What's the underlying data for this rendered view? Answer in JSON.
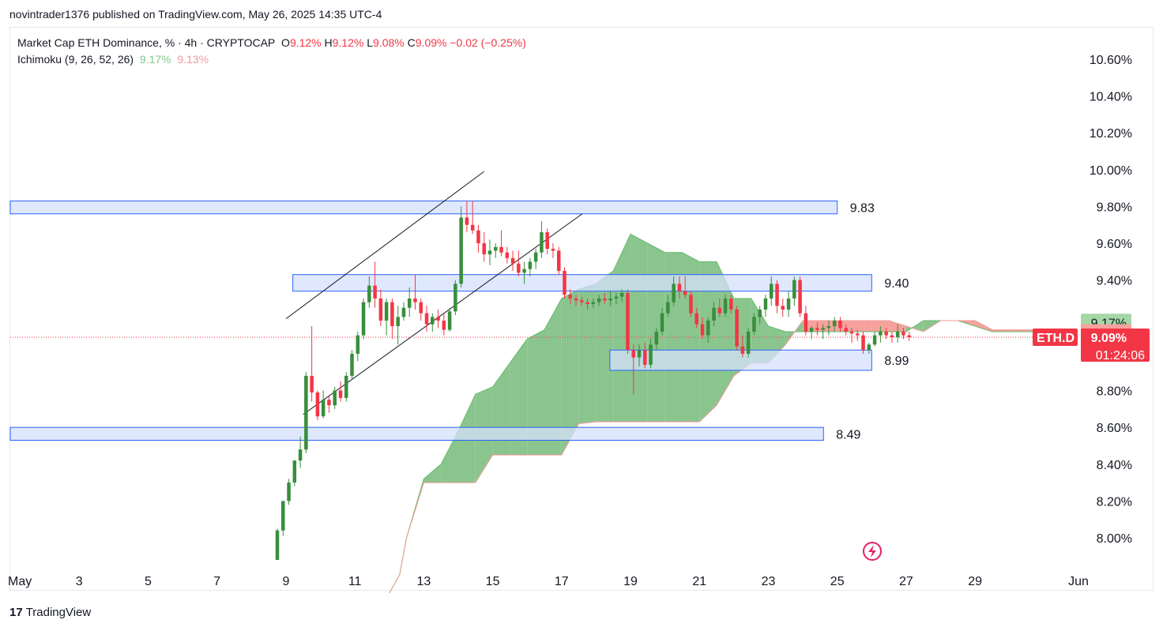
{
  "header": {
    "publish_line": "novintrader1376 published on TradingView.com, May 26, 2025 14:35 UTC-4"
  },
  "legend": {
    "symbol_line": "Market Cap ETH Dominance, % · 4h · CRYPTOCAP",
    "o_label": "O",
    "o_value": "9.12%",
    "h_label": "H",
    "h_value": "9.12%",
    "l_label": "L",
    "l_value": "9.08%",
    "c_label": "C",
    "c_value": "9.09%",
    "change": "−0.02 (−0.25%)",
    "indicator": "Ichimoku (9, 26, 52, 26)",
    "ind_val1": "9.17%",
    "ind_val2": "9.13%"
  },
  "brand": {
    "logo_text": "17",
    "name": "TradingView"
  },
  "colors": {
    "up": "#388e3c",
    "down": "#f23645",
    "cloud_bull": "#8bc58e",
    "cloud_bear": "#f6a19d",
    "zone_fill": "#d4e0fb",
    "zone_stroke": "#2962ff",
    "price_label": "#f23645"
  },
  "chart_data": {
    "type": "candlestick",
    "symbol": "ETH.D",
    "timeframe": "4h",
    "ylim": [
      7.85,
      10.75
    ],
    "y_ticks": [
      "8.00%",
      "8.20%",
      "8.40%",
      "8.60%",
      "8.80%",
      "9.40%",
      "9.60%",
      "9.80%",
      "10.00%",
      "10.20%",
      "10.40%",
      "10.60%"
    ],
    "y_tick_values": [
      8.0,
      8.2,
      8.4,
      8.6,
      8.8,
      9.4,
      9.6,
      9.8,
      10.0,
      10.2,
      10.4,
      10.6
    ],
    "x_ticks": [
      "May",
      "3",
      "5",
      "7",
      "9",
      "11",
      "13",
      "15",
      "17",
      "19",
      "21",
      "23",
      "25",
      "27",
      "29",
      "Jun"
    ],
    "x_tick_days": [
      1,
      3,
      5,
      7,
      9,
      11,
      13,
      15,
      17,
      19,
      21,
      23,
      25,
      27,
      29,
      32
    ],
    "xlim_days": [
      1.0,
      32.0
    ],
    "zones": [
      {
        "low": 9.76,
        "high": 9.83,
        "label": "9.83",
        "start_day": 1.0,
        "end_day": 25.0
      },
      {
        "low": 9.34,
        "high": 9.43,
        "label": "9.40",
        "start_day": 9.2,
        "end_day": 26.0
      },
      {
        "low": 8.91,
        "high": 9.02,
        "label": "8.99",
        "start_day": 18.4,
        "end_day": 26.0
      },
      {
        "low": 8.53,
        "high": 8.6,
        "label": "8.49",
        "start_day": 1.0,
        "end_day": 24.6
      }
    ],
    "channel_lines": [
      {
        "from": [
          9.0,
          9.19
        ],
        "to": [
          14.75,
          9.99
        ]
      },
      {
        "from": [
          9.5,
          8.67
        ],
        "to": [
          17.6,
          9.76
        ]
      }
    ],
    "current_price": {
      "value": 9.09,
      "label": "9.09%",
      "countdown": "01:24:06",
      "symbol_tag": "ETH.D"
    },
    "ichimoku_labels": [
      {
        "value": 9.17,
        "label": "9.17%"
      },
      {
        "value": 9.13,
        "label": "9.13%"
      }
    ],
    "cloud_days": [
      12.0,
      12.3,
      12.5,
      13.0,
      13.5,
      14.0,
      14.5,
      15.0,
      15.5,
      16.0,
      16.5,
      17.0,
      17.5,
      18.0,
      18.5,
      19.0,
      19.5,
      20.0,
      20.5,
      21.0,
      21.5,
      22.0,
      22.5,
      23.0,
      23.5,
      24.0,
      24.5,
      25.0,
      25.5,
      26.0,
      26.5,
      27.0,
      27.5,
      28.0,
      28.5,
      29.0,
      29.5,
      30.0,
      30.5,
      31.0
    ],
    "span_a": [
      7.7,
      7.8,
      8.0,
      8.32,
      8.4,
      8.58,
      8.78,
      8.82,
      8.95,
      9.08,
      9.13,
      9.3,
      9.35,
      9.38,
      9.45,
      9.65,
      9.6,
      9.55,
      9.55,
      9.5,
      9.5,
      9.3,
      9.3,
      9.15,
      9.12,
      9.12,
      9.12,
      9.12,
      9.12,
      9.12,
      9.12,
      9.12,
      9.18,
      9.18,
      9.18,
      9.15,
      9.12,
      9.12,
      9.12,
      9.12
    ],
    "span_b": [
      7.7,
      7.8,
      8.0,
      8.3,
      8.3,
      8.3,
      8.3,
      8.45,
      8.45,
      8.45,
      8.45,
      8.45,
      8.62,
      8.63,
      8.63,
      8.63,
      8.63,
      8.63,
      8.63,
      8.63,
      8.72,
      8.88,
      8.95,
      8.95,
      9.05,
      9.18,
      9.18,
      9.18,
      9.18,
      9.18,
      9.18,
      9.15,
      9.12,
      9.18,
      9.18,
      9.18,
      9.13,
      9.13,
      9.13,
      9.13
    ],
    "candle_start_day": 8.75,
    "candle_step_days": 0.1667,
    "ohlc": [
      [
        7.88,
        8.05,
        7.88,
        8.04
      ],
      [
        8.04,
        8.2,
        8.01,
        8.2
      ],
      [
        8.2,
        8.32,
        8.18,
        8.3
      ],
      [
        8.3,
        8.42,
        8.28,
        8.42
      ],
      [
        8.42,
        8.55,
        8.38,
        8.48
      ],
      [
        8.48,
        8.9,
        8.46,
        8.88
      ],
      [
        8.88,
        9.15,
        8.74,
        8.79
      ],
      [
        8.79,
        8.8,
        8.64,
        8.66
      ],
      [
        8.66,
        8.8,
        8.65,
        8.75
      ],
      [
        8.75,
        8.77,
        8.68,
        8.72
      ],
      [
        8.72,
        8.82,
        8.7,
        8.8
      ],
      [
        8.8,
        8.85,
        8.74,
        8.76
      ],
      [
        8.76,
        8.9,
        8.74,
        8.88
      ],
      [
        8.88,
        9.02,
        8.86,
        9.0
      ],
      [
        9.0,
        9.12,
        8.96,
        9.1
      ],
      [
        9.1,
        9.3,
        9.08,
        9.28
      ],
      [
        9.28,
        9.42,
        9.25,
        9.37
      ],
      [
        9.37,
        9.5,
        9.25,
        9.3
      ],
      [
        9.3,
        9.35,
        9.15,
        9.18
      ],
      [
        9.18,
        9.3,
        9.1,
        9.28
      ],
      [
        9.28,
        9.3,
        9.08,
        9.15
      ],
      [
        9.15,
        9.26,
        9.05,
        9.2
      ],
      [
        9.2,
        9.28,
        9.18,
        9.25
      ],
      [
        9.25,
        9.36,
        9.2,
        9.3
      ],
      [
        9.3,
        9.43,
        9.24,
        9.28
      ],
      [
        9.28,
        9.3,
        9.18,
        9.22
      ],
      [
        9.22,
        9.26,
        9.12,
        9.16
      ],
      [
        9.16,
        9.22,
        9.12,
        9.2
      ],
      [
        9.2,
        9.24,
        9.14,
        9.18
      ],
      [
        9.18,
        9.22,
        9.1,
        9.13
      ],
      [
        9.13,
        9.25,
        9.12,
        9.23
      ],
      [
        9.23,
        9.4,
        9.21,
        9.38
      ],
      [
        9.38,
        9.8,
        9.36,
        9.74
      ],
      [
        9.74,
        9.83,
        9.66,
        9.7
      ],
      [
        9.7,
        9.83,
        9.65,
        9.67
      ],
      [
        9.67,
        9.7,
        9.55,
        9.6
      ],
      [
        9.6,
        9.66,
        9.5,
        9.54
      ],
      [
        9.54,
        9.62,
        9.48,
        9.56
      ],
      [
        9.56,
        9.6,
        9.52,
        9.58
      ],
      [
        9.58,
        9.67,
        9.53,
        9.55
      ],
      [
        9.55,
        9.58,
        9.49,
        9.52
      ],
      [
        9.52,
        9.56,
        9.45,
        9.49
      ],
      [
        9.49,
        9.56,
        9.42,
        9.44
      ],
      [
        9.44,
        9.5,
        9.38,
        9.46
      ],
      [
        9.46,
        9.52,
        9.42,
        9.5
      ],
      [
        9.5,
        9.57,
        9.46,
        9.55
      ],
      [
        9.55,
        9.72,
        9.52,
        9.66
      ],
      [
        9.66,
        9.68,
        9.54,
        9.57
      ],
      [
        9.57,
        9.6,
        9.52,
        9.56
      ],
      [
        9.56,
        9.58,
        9.43,
        9.45
      ],
      [
        9.45,
        9.47,
        9.3,
        9.32
      ],
      [
        9.32,
        9.35,
        9.27,
        9.3
      ],
      [
        9.3,
        9.32,
        9.26,
        9.29
      ],
      [
        9.29,
        9.31,
        9.26,
        9.28
      ],
      [
        9.28,
        9.3,
        9.24,
        9.27
      ],
      [
        9.27,
        9.3,
        9.25,
        9.28
      ],
      [
        9.28,
        9.32,
        9.26,
        9.3
      ],
      [
        9.3,
        9.33,
        9.27,
        9.29
      ],
      [
        9.29,
        9.34,
        9.26,
        9.3
      ],
      [
        9.3,
        9.33,
        9.27,
        9.31
      ],
      [
        9.31,
        9.35,
        9.28,
        9.33
      ],
      [
        9.33,
        9.35,
        9.0,
        9.02
      ],
      [
        9.02,
        9.05,
        8.78,
        8.98
      ],
      [
        8.98,
        9.05,
        8.93,
        9.02
      ],
      [
        9.02,
        9.06,
        8.92,
        8.94
      ],
      [
        8.94,
        9.08,
        8.92,
        9.05
      ],
      [
        9.05,
        9.14,
        9.02,
        9.12
      ],
      [
        9.12,
        9.25,
        9.1,
        9.22
      ],
      [
        9.22,
        9.32,
        9.2,
        9.28
      ],
      [
        9.28,
        9.42,
        9.26,
        9.38
      ],
      [
        9.38,
        9.42,
        9.3,
        9.34
      ],
      [
        9.34,
        9.42,
        9.3,
        9.32
      ],
      [
        9.32,
        9.34,
        9.2,
        9.22
      ],
      [
        9.22,
        9.25,
        9.14,
        9.16
      ],
      [
        9.16,
        9.2,
        9.08,
        9.1
      ],
      [
        9.1,
        9.2,
        9.06,
        9.18
      ],
      [
        9.18,
        9.28,
        9.15,
        9.25
      ],
      [
        9.25,
        9.3,
        9.2,
        9.22
      ],
      [
        9.22,
        9.32,
        9.2,
        9.3
      ],
      [
        9.3,
        9.32,
        9.22,
        9.24
      ],
      [
        9.24,
        9.26,
        9.02,
        9.04
      ],
      [
        9.04,
        9.1,
        8.98,
        9.0
      ],
      [
        9.0,
        9.14,
        8.98,
        9.12
      ],
      [
        9.12,
        9.22,
        9.1,
        9.2
      ],
      [
        9.2,
        9.26,
        9.16,
        9.24
      ],
      [
        9.24,
        9.32,
        9.2,
        9.3
      ],
      [
        9.3,
        9.42,
        9.26,
        9.38
      ],
      [
        9.38,
        9.4,
        9.22,
        9.26
      ],
      [
        9.26,
        9.3,
        9.2,
        9.24
      ],
      [
        9.24,
        9.34,
        9.2,
        9.3
      ],
      [
        9.3,
        9.42,
        9.26,
        9.4
      ],
      [
        9.4,
        9.42,
        9.2,
        9.22
      ],
      [
        9.22,
        9.26,
        9.1,
        9.12
      ],
      [
        9.12,
        9.15,
        9.08,
        9.14
      ],
      [
        9.14,
        9.17,
        9.1,
        9.13
      ],
      [
        9.13,
        9.16,
        9.08,
        9.14
      ],
      [
        9.14,
        9.18,
        9.1,
        9.15
      ],
      [
        9.15,
        9.2,
        9.12,
        9.18
      ],
      [
        9.18,
        9.2,
        9.12,
        9.14
      ],
      [
        9.14,
        9.16,
        9.1,
        9.12
      ],
      [
        9.12,
        9.14,
        9.06,
        9.11
      ],
      [
        9.11,
        9.13,
        9.07,
        9.1
      ],
      [
        9.1,
        9.12,
        9.0,
        9.02
      ],
      [
        9.02,
        9.06,
        9.0,
        9.05
      ],
      [
        9.05,
        9.12,
        9.04,
        9.1
      ],
      [
        9.1,
        9.15,
        9.06,
        9.12
      ],
      [
        9.12,
        9.14,
        9.08,
        9.1
      ],
      [
        9.1,
        9.12,
        9.06,
        9.09
      ],
      [
        9.09,
        9.16,
        9.06,
        9.12
      ],
      [
        9.12,
        9.14,
        9.08,
        9.1
      ],
      [
        9.1,
        9.12,
        9.07,
        9.09
      ]
    ]
  }
}
